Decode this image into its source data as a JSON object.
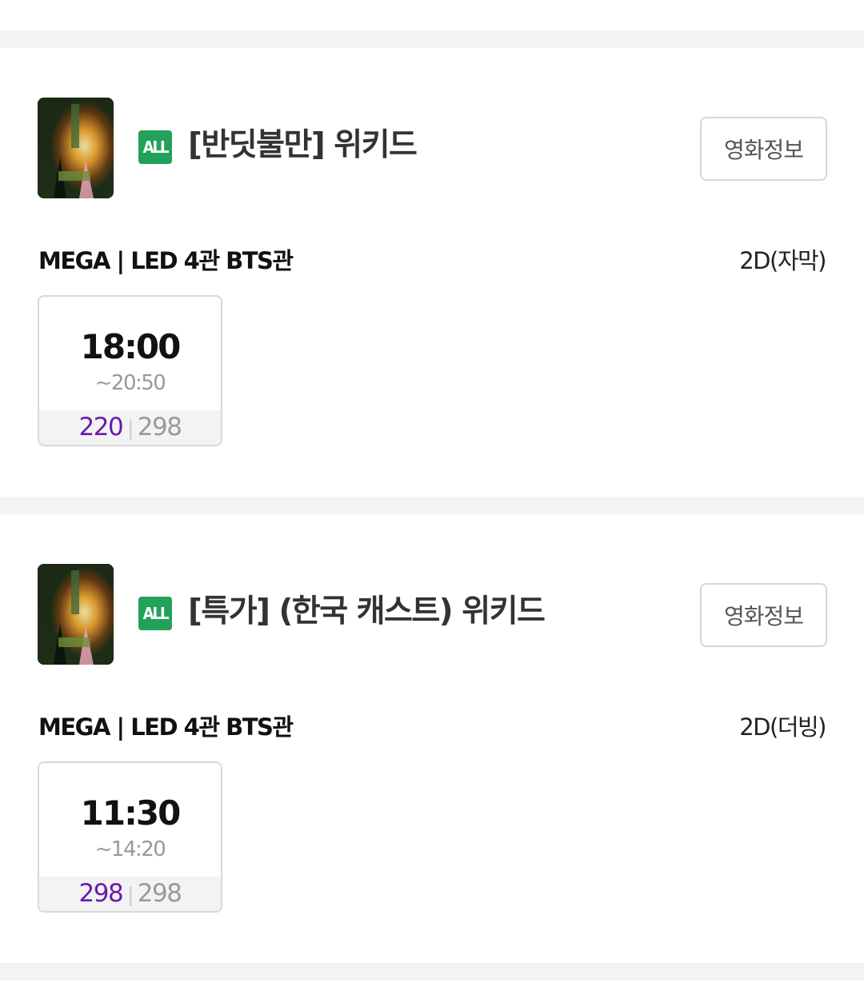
{
  "movies": [
    {
      "rating": "ALL",
      "title": "[반딧불만] 위키드",
      "info_button": "영화정보",
      "hall": "MEGA | LED 4관 BTS관",
      "format": "2D(자막)",
      "showtime": {
        "start": "18:00",
        "end": "~20:50",
        "available": "220",
        "separator": "|",
        "total": "298"
      }
    },
    {
      "rating": "ALL",
      "title": "[특가] (한국 캐스트) 위키드",
      "info_button": "영화정보",
      "hall": "MEGA | LED 4관 BTS관",
      "format": "2D(더빙)",
      "showtime": {
        "start": "11:30",
        "end": "~14:20",
        "available": "298",
        "separator": "|",
        "total": "298"
      }
    }
  ],
  "colors": {
    "rating_badge": "#23a15b",
    "available_seats": "#6a1ab0",
    "divider": "#f3f3f3"
  }
}
